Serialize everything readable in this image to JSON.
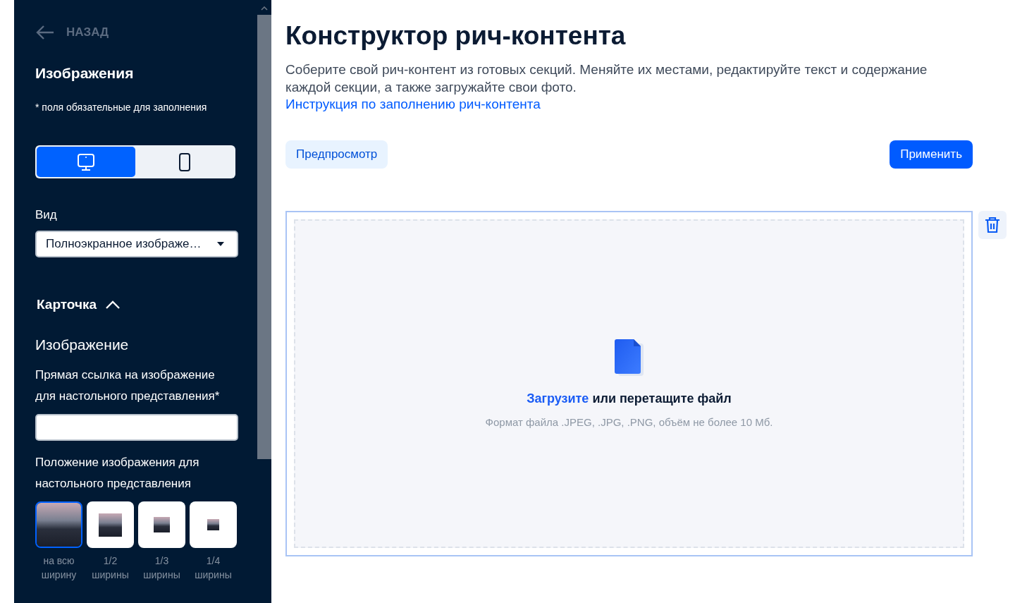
{
  "sidebar": {
    "back": "НАЗАД",
    "title": "Изображения",
    "required_note": "* поля обязательные для заполнения",
    "devices": [
      {
        "kind": "desktop",
        "selected": true
      },
      {
        "kind": "mobile",
        "selected": false
      }
    ],
    "view_label": "Вид",
    "view_value": "Полноэкранное изображе…",
    "section": {
      "title": "Карточка",
      "expanded": true
    },
    "subtitle": "Изображение",
    "link_label": "Прямая ссылка на изображение для настольного представления*",
    "position_label": "Положение изображения для настольного представления",
    "positions": [
      {
        "label": "на всю ширину",
        "kind": "full",
        "selected": true
      },
      {
        "label": "1/2 ширины",
        "kind": "half",
        "selected": false
      },
      {
        "label": "1/3 ширины",
        "kind": "third",
        "selected": false
      },
      {
        "label": "1/4 ширины",
        "kind": "quarter",
        "selected": false
      }
    ]
  },
  "main": {
    "title": "Конструктор рич-контента",
    "description": "Соберите свой рич-контент из готовых секций. Меняйте их местами, редактируйте текст и содержание каждой секции, а также загружайте свои фото.",
    "instruction_link": "Инструкция по заполнению рич-контента",
    "preview_button": "Предпросмотр",
    "apply_button": "Применить",
    "upload": {
      "link": "Загрузите",
      "text": "или перетащите файл",
      "hint": "Формат файла .JPEG, .JPG, .PNG, объём не более 10 Мб."
    }
  }
}
